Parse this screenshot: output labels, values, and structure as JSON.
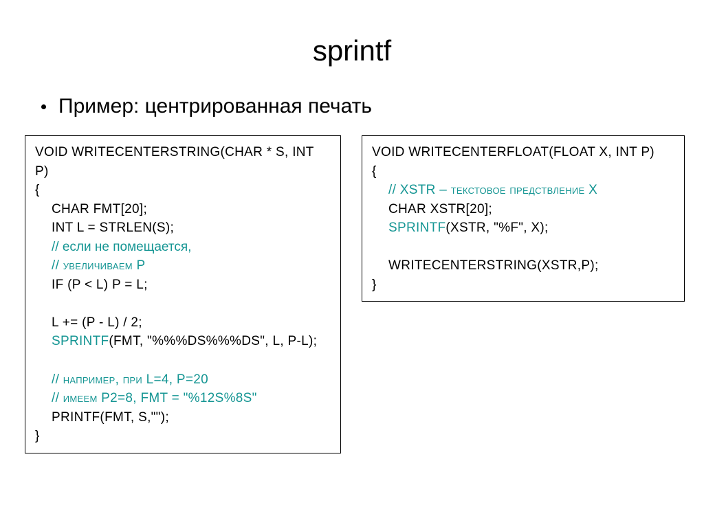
{
  "title": "sprintf",
  "bullet": "Пример: центрированная печать",
  "left": {
    "l1a": "V",
    "l1b": "OID ",
    "l1c": "W",
    "l1d": "RITE",
    "l1e": "C",
    "l1f": "ENTER",
    "l1g": "S",
    "l1h": "TRING",
    "l1i": "(",
    "l1j": "CHAR",
    "l1k": " * ",
    "l1l": "S",
    "l1m": ", ",
    "l1n": "INT P",
    "l1o": ")",
    "l2": "{",
    "l3a": "C",
    "l3b": "HAR FMT",
    "l3c": "[20];",
    "l4a": "I",
    "l4b": "NT L",
    "l4c": " = ",
    "l4d": "STRLEN",
    "l4e": "(",
    "l4f": "S",
    "l4g": ");",
    "l5": "// если не помещается,",
    "l6a": "// увеличиваем ",
    "l6b": "P",
    "l7a": "IF ",
    "l7b": "(",
    "l7c": "P",
    "l7d": " < ",
    "l7e": "L",
    "l7f": ") ",
    "l7g": "P",
    "l7h": " = ",
    "l7i": "L",
    "l7j": ";",
    "l8a": "L",
    "l8b": " += (",
    "l8c": "P",
    "l8d": " - ",
    "l8e": "L",
    "l8f": ") / 2;",
    "l9a": "S",
    "l9b": "PRINTF",
    "l9c": "(",
    "l9d": "FMT",
    "l9e": ", \"%%%",
    "l9f": "DS",
    "l9g": "%%%",
    "l9h": "DS",
    "l9i": "\", ",
    "l9j": "L",
    "l9k": ", ",
    "l9l": "P",
    "l9m": "-",
    "l9n": "L",
    "l9o": ");",
    "l10a": "// например, при ",
    "l10b": "L",
    "l10c": "=4, ",
    "l10d": "P",
    "l10e": "=20",
    "l11a": "// имеем ",
    "l11b": "P",
    "l11c": "2=8, ",
    "l11d": "FMT",
    "l11e": " = \"%12",
    "l11f": "S",
    "l11g": "%8",
    "l11h": "S",
    "l11i": "\"",
    "l12a": "P",
    "l12b": "RINTF",
    "l12c": "(",
    "l12d": "FMT",
    "l12e": ", ",
    "l12f": "S",
    "l12g": ",\"\");",
    "l13": "}"
  },
  "right": {
    "r1a": "V",
    "r1b": "OID ",
    "r1c": "W",
    "r1d": "RITE",
    "r1e": "C",
    "r1f": "ENTER",
    "r1g": "F",
    "r1h": "LOAT",
    "r1i": "(",
    "r1j": "FLOAT X",
    "r1k": ", ",
    "r1l": "INT P",
    "r1m": ")",
    "r2": "{",
    "r3a": "// ",
    "r3b": "XSTR",
    "r3c": " – текстовое предствление ",
    "r3d": "X",
    "r4a": "C",
    "r4b": "HAR XSTR",
    "r4c": "[20];",
    "r5a": "S",
    "r5b": "PRINTF",
    "r5c": "(",
    "r5d": "XSTR",
    "r5e": ", \"%",
    "r5f": "F",
    "r5g": "\", ",
    "r5h": "X",
    "r5i": ");",
    "r6a": "W",
    "r6b": "RITE",
    "r6c": "C",
    "r6d": "ENTER",
    "r6e": "S",
    "r6f": "TRING",
    "r6g": "(",
    "r6h": "XSTR",
    "r6i": ",",
    "r6j": "P",
    "r6k": ");",
    "r7": "}"
  }
}
